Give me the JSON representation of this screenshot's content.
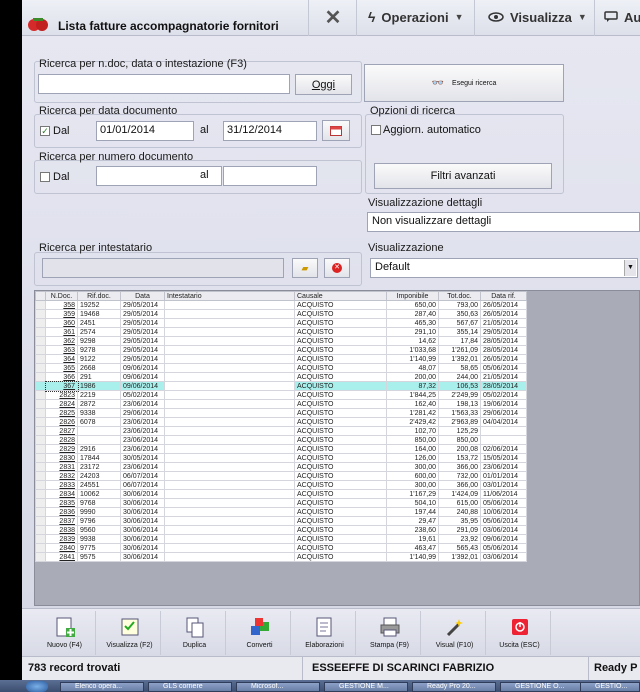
{
  "window": {
    "title": "Lista fatture accompagnatorie fornitori"
  },
  "menu": {
    "close_icon": "close-icon",
    "operazioni": "Operazioni",
    "visualizza": "Visualizza",
    "au": "Au"
  },
  "search": {
    "group1_label": "Ricerca per n.doc, data o intestazione (F3)",
    "main_value": "",
    "oggi_label": "Oggi",
    "esegui_label": "Esegui ricerca",
    "group2_label": "Ricerca per data documento",
    "dal_label": "Dal",
    "dal_checked": true,
    "date_from": "01/01/2014",
    "al_label": "al",
    "date_to": "31/12/2014",
    "group3_label": "Ricerca per numero documento",
    "dal2_label": "Dal",
    "dal2_checked": false,
    "num_from": "",
    "al2_label": "al",
    "num_to": "",
    "group4_label": "Ricerca per intestatario",
    "intestatario": ""
  },
  "options": {
    "label": "Opzioni di ricerca",
    "aggiorn_label": "Aggiorn. automatico",
    "aggiorn_checked": false,
    "filtri_label": "Filtri avanzati",
    "dettagli_label": "Visualizzazione dettagli",
    "dettagli_value": "Non visualizzare dettagli",
    "vis_label": "Visualizzazione",
    "vis_value": "Default"
  },
  "table": {
    "columns": [
      "N.Doc.",
      "Rif.doc.",
      "Data",
      "Intestatario",
      "Causale",
      "Imponibile",
      "Tot.doc.",
      "Data rif."
    ],
    "highlight_index": 9,
    "rows": [
      [
        "358",
        "19252",
        "29/05/2014",
        "",
        "ACQUISTO",
        "650,00",
        "793,00",
        "26/05/2014"
      ],
      [
        "359",
        "19468",
        "29/05/2014",
        "",
        "ACQUISTO",
        "287,40",
        "350,63",
        "26/05/2014"
      ],
      [
        "360",
        "2451",
        "29/05/2014",
        "",
        "ACQUISTO",
        "465,30",
        "567,67",
        "21/05/2014"
      ],
      [
        "361",
        "2574",
        "29/05/2014",
        "",
        "ACQUISTO",
        "291,10",
        "355,14",
        "29/05/2014"
      ],
      [
        "362",
        "9298",
        "29/05/2014",
        "",
        "ACQUISTO",
        "14,62",
        "17,84",
        "28/05/2014"
      ],
      [
        "363",
        "9278",
        "29/05/2014",
        "",
        "ACQUISTO",
        "1'033,68",
        "1'261,09",
        "28/05/2014"
      ],
      [
        "364",
        "9122",
        "29/05/2014",
        "",
        "ACQUISTO",
        "1'140,99",
        "1'392,01",
        "26/05/2014"
      ],
      [
        "365",
        "2668",
        "09/06/2014",
        "",
        "ACQUISTO",
        "48,07",
        "58,65",
        "05/06/2014"
      ],
      [
        "366",
        "291",
        "09/06/2014",
        "",
        "ACQUISTO",
        "200,00",
        "244,00",
        "21/05/2014"
      ],
      [
        "367",
        "1986",
        "09/06/2014",
        "",
        "ACQUISTO",
        "87,32",
        "106,53",
        "28/05/2014"
      ],
      [
        "2823",
        "2219",
        "05/02/2014",
        "",
        "ACQUISTO",
        "1'844,25",
        "2'249,99",
        "05/02/2014"
      ],
      [
        "2824",
        "2872",
        "23/06/2014",
        "",
        "ACQUISTO",
        "162,40",
        "198,13",
        "19/06/2014"
      ],
      [
        "2825",
        "9338",
        "29/06/2014",
        "",
        "ACQUISTO",
        "1'281,42",
        "1'563,33",
        "29/06/2014"
      ],
      [
        "2826",
        "6078",
        "23/06/2014",
        "",
        "ACQUISTO",
        "2'429,42",
        "2'963,89",
        "04/04/2014"
      ],
      [
        "2827",
        "",
        "23/06/2014",
        "",
        "ACQUISTO",
        "102,70",
        "125,29",
        ""
      ],
      [
        "2828",
        "",
        "23/06/2014",
        "",
        "ACQUISTO",
        "850,00",
        "850,00",
        ""
      ],
      [
        "2829",
        "2916",
        "23/06/2014",
        "",
        "ACQUISTO",
        "164,00",
        "200,08",
        "02/06/2014"
      ],
      [
        "2830",
        "17844",
        "30/05/2014",
        "",
        "ACQUISTO",
        "126,00",
        "153,72",
        "15/05/2014"
      ],
      [
        "2831",
        "23172",
        "23/06/2014",
        "",
        "ACQUISTO",
        "300,00",
        "366,00",
        "23/06/2014"
      ],
      [
        "2832",
        "24203",
        "06/07/2014",
        "",
        "ACQUISTO",
        "600,00",
        "732,00",
        "01/01/2014"
      ],
      [
        "2833",
        "24551",
        "06/07/2014",
        "",
        "ACQUISTO",
        "300,00",
        "366,00",
        "03/01/2014"
      ],
      [
        "2834",
        "10062",
        "30/06/2014",
        "",
        "ACQUISTO",
        "1'167,29",
        "1'424,09",
        "11/06/2014"
      ],
      [
        "2835",
        "9768",
        "30/06/2014",
        "",
        "ACQUISTO",
        "504,10",
        "615,00",
        "05/06/2014"
      ],
      [
        "2836",
        "9990",
        "30/06/2014",
        "",
        "ACQUISTO",
        "197,44",
        "240,88",
        "10/06/2014"
      ],
      [
        "2837",
        "9796",
        "30/06/2014",
        "",
        "ACQUISTO",
        "29,47",
        "35,95",
        "05/06/2014"
      ],
      [
        "2838",
        "9560",
        "30/06/2014",
        "",
        "ACQUISTO",
        "238,60",
        "291,09",
        "03/06/2014"
      ],
      [
        "2839",
        "9938",
        "30/06/2014",
        "",
        "ACQUISTO",
        "19,61",
        "23,92",
        "09/06/2014"
      ],
      [
        "2840",
        "9775",
        "30/06/2014",
        "",
        "ACQUISTO",
        "463,47",
        "565,43",
        "05/06/2014"
      ],
      [
        "2841",
        "9575",
        "30/06/2014",
        "",
        "ACQUISTO",
        "1'140,99",
        "1'392,01",
        "03/06/2014"
      ]
    ]
  },
  "toolbar": {
    "items": [
      {
        "label": "Nuovo (F4)",
        "icon": "new-icon"
      },
      {
        "label": "Visualizza (F2)",
        "icon": "view-icon"
      },
      {
        "label": "Duplica",
        "icon": "duplicate-icon"
      },
      {
        "label": "Converti",
        "icon": "convert-icon"
      },
      {
        "label": "Elaborazioni",
        "icon": "process-icon"
      },
      {
        "label": "Stampa (F9)",
        "icon": "print-icon"
      },
      {
        "label": "Visual (F10)",
        "icon": "wand-icon"
      },
      {
        "label": "Uscita (ESC)",
        "icon": "exit-icon"
      }
    ]
  },
  "status": {
    "records": "783 record trovati",
    "company": "ESSEEFFE DI SCARINCI FABRIZIO",
    "ready": "Ready P"
  },
  "taskbar": {
    "items": [
      "Elenco opera...",
      "GLS corriere",
      "Microsof...",
      "GESTIONE M...",
      "Ready Pro 20...",
      "GESTIONE O...",
      "GESTIO..."
    ]
  }
}
